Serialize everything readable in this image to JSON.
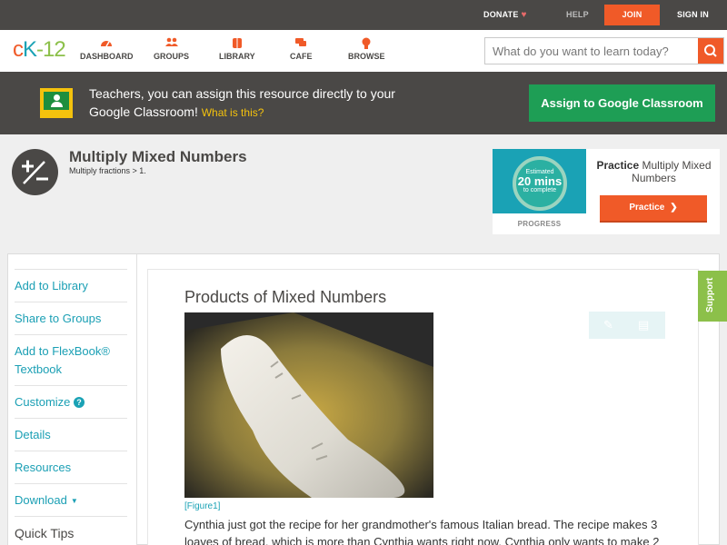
{
  "topbar": {
    "donate": "DONATE",
    "help": "HELP",
    "join": "JOIN",
    "sign_in": "SIGN IN"
  },
  "logo": {
    "text_c": "c",
    "text_k": "K",
    "text_n": "-12"
  },
  "nav": {
    "items": [
      {
        "label": "DASHBOARD",
        "icon": "dashboard-icon"
      },
      {
        "label": "GROUPS",
        "icon": "groups-icon"
      },
      {
        "label": "LIBRARY",
        "icon": "library-icon"
      },
      {
        "label": "CAFE",
        "icon": "cafe-icon"
      },
      {
        "label": "BROWSE",
        "icon": "browse-icon"
      }
    ]
  },
  "search": {
    "placeholder": "What do you want to learn today?"
  },
  "banner": {
    "message": "Teachers, you can assign this resource directly to your Google Classroom!",
    "link": "What is this?",
    "assign_button": "Assign to Google Classroom"
  },
  "page": {
    "title": "Multiply Mixed Numbers",
    "breadcrumb": "Multiply fractions > 1."
  },
  "practice": {
    "estimated": "Estimated",
    "minutes": "20 mins",
    "to_complete": "to complete",
    "progress_label": "PROGRESS",
    "label_bold": "Practice",
    "label_rest": "Multiply Mixed Numbers",
    "button": "Practice"
  },
  "sidebar": {
    "items": [
      "Add to Library",
      "Share to Groups",
      "Add to FlexBook® Textbook",
      "Customize",
      "Details",
      "Resources",
      "Download",
      "Quick Tips"
    ]
  },
  "article": {
    "title": "Products of Mixed Numbers",
    "caption": "[Figure1]",
    "body": "Cynthia just got the recipe for her grandmother's famous Italian bread. The recipe makes 3 loaves of bread, which is more than Cynthia wants right now. Cynthia only wants to make 2"
  },
  "support": "Support",
  "colors": {
    "accent": "#f05a28",
    "brand_teal": "#1aa2b5",
    "brand_green": "#8cc04a",
    "google_green": "#1e9e55",
    "dark_bar": "#4a4846"
  }
}
